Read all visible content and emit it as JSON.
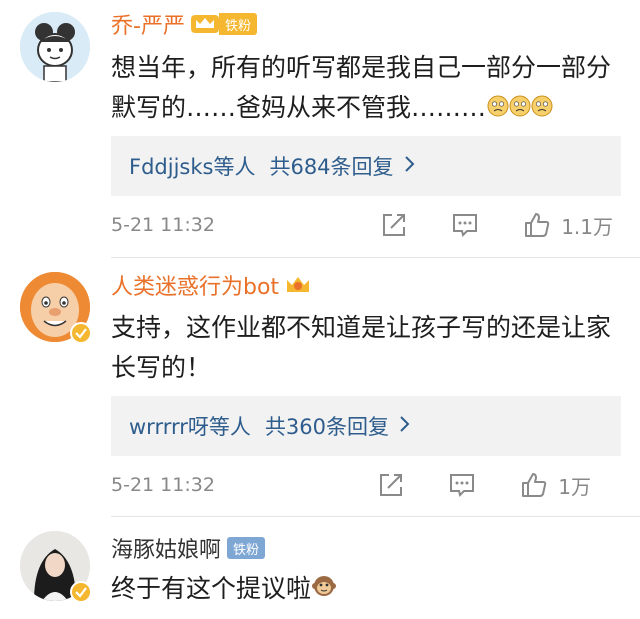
{
  "comments": [
    {
      "username": "乔-严严",
      "badge": "铁粉",
      "text": "想当年，所有的听写都是我自己一部分一部分默写的……爸妈从来不管我………",
      "replies_users": "Fddjjsks等人",
      "replies_count": "共684条回复",
      "time": "5-21 11:32",
      "likes": "1.1万"
    },
    {
      "username": "人类迷惑行为bot",
      "text": "支持，这作业都不知道是让孩子写的还是让家长写的！",
      "replies_users": "wrrrrr呀等人",
      "replies_count": "共360条回复",
      "time": "5-21 11:32",
      "likes": "1万"
    },
    {
      "username": "海豚姑娘啊",
      "badge": "铁粉",
      "text": "终于有这个提议啦"
    }
  ],
  "colors": {
    "username": "#e9712a",
    "reply_link": "#2e5d8d",
    "badge_bg": "#7fa7d4",
    "meta_text": "#888888"
  },
  "icons": [
    "crown-badge-icon",
    "share-icon",
    "comment-icon",
    "like-icon",
    "chevron-right-icon",
    "verified-icon",
    "emoji-face-icon",
    "monkey-emoji-icon"
  ]
}
